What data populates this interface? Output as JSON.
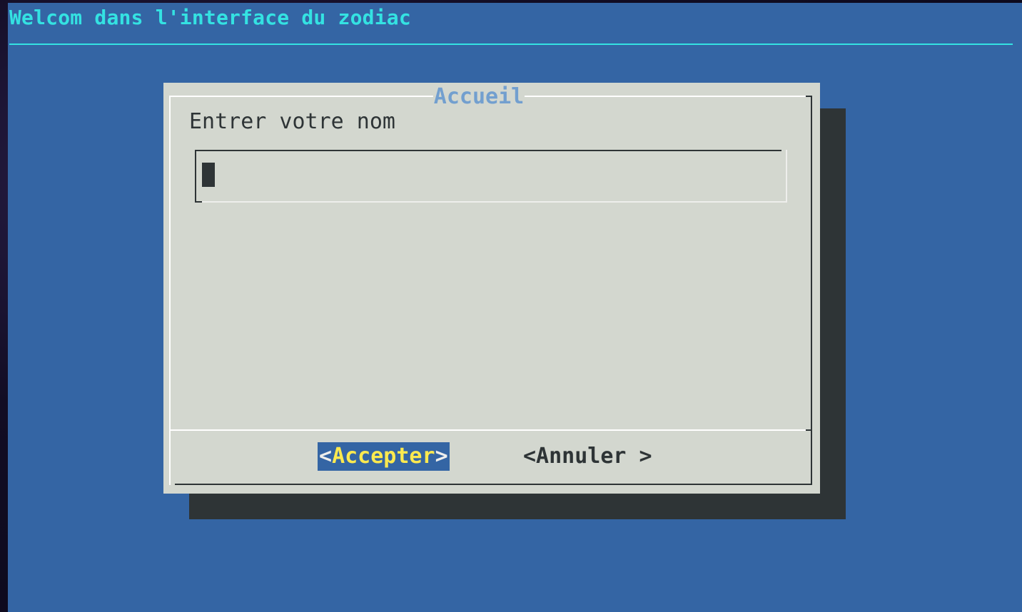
{
  "backtitle": "Welcom dans l'interface du zodiac",
  "dialog": {
    "title": "Accueil",
    "prompt": "Entrer votre nom",
    "input_value": ""
  },
  "buttons": {
    "accept": {
      "open": "<",
      "hotkey": "A",
      "rest": "ccepter",
      "close": ">"
    },
    "cancel": {
      "label": "<Annuler >"
    }
  },
  "colors": {
    "background": "#3465a4",
    "dialog": "#d3d7cf",
    "shadow": "#2e3436",
    "backtitle": "#34e2e2",
    "dialog_title": "#729fcf",
    "button_hotkey": "#fce94f"
  }
}
